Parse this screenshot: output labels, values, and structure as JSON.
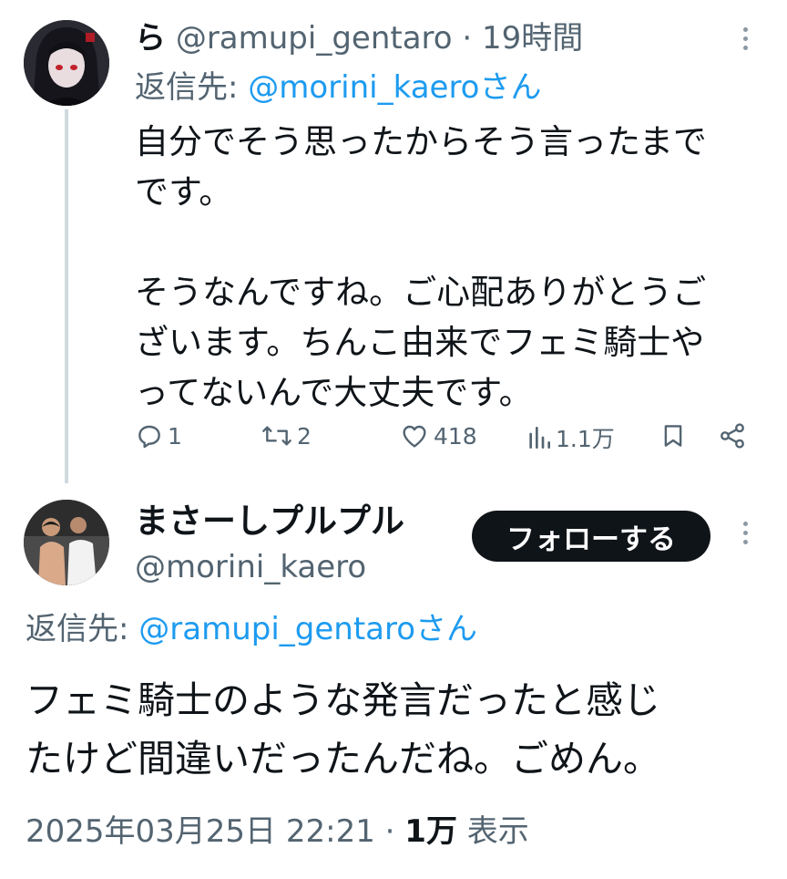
{
  "tweet1": {
    "author_name": "ら",
    "author_handle": "@ramupi_gentaro",
    "separator": "·",
    "time": "19時間",
    "reply_prefix": "返信先: ",
    "reply_to": "@morini_kaero",
    "reply_suffix": "さん",
    "body_lines": [
      "自分でそう思ったからそう言ったまで",
      "です。",
      "",
      "そうなんですね。ご心配ありがとうご",
      "ざいます。ちんこ由来でフェミ騎士や",
      "ってないんで大丈夫です。"
    ],
    "actions": {
      "replies": "1",
      "retweets": "2",
      "likes": "418",
      "views": "1.1万"
    }
  },
  "tweet2": {
    "author_name": "まさーしプルプル",
    "author_handle": "@morini_kaero",
    "follow_label": "フォローする",
    "reply_prefix": "返信先: ",
    "reply_to": "@ramupi_gentaro",
    "reply_suffix": "さん",
    "body_lines": [
      "フェミ騎士のような発言だったと感じ",
      "たけど間違いだったんだね。ごめん。"
    ],
    "timestamp": "2025年03月25日 22:21",
    "separator": " · ",
    "views_count": "1万",
    "views_label": " 表示"
  },
  "icons": [
    "more-icon",
    "reply-icon",
    "retweet-icon",
    "like-icon",
    "views-icon",
    "bookmark-icon",
    "share-icon"
  ],
  "colors": {
    "text": "#0f1419",
    "secondary": "#536471",
    "link": "#1d9bf0",
    "button_bg": "#0f1419",
    "thread_line": "#cfd9de"
  }
}
